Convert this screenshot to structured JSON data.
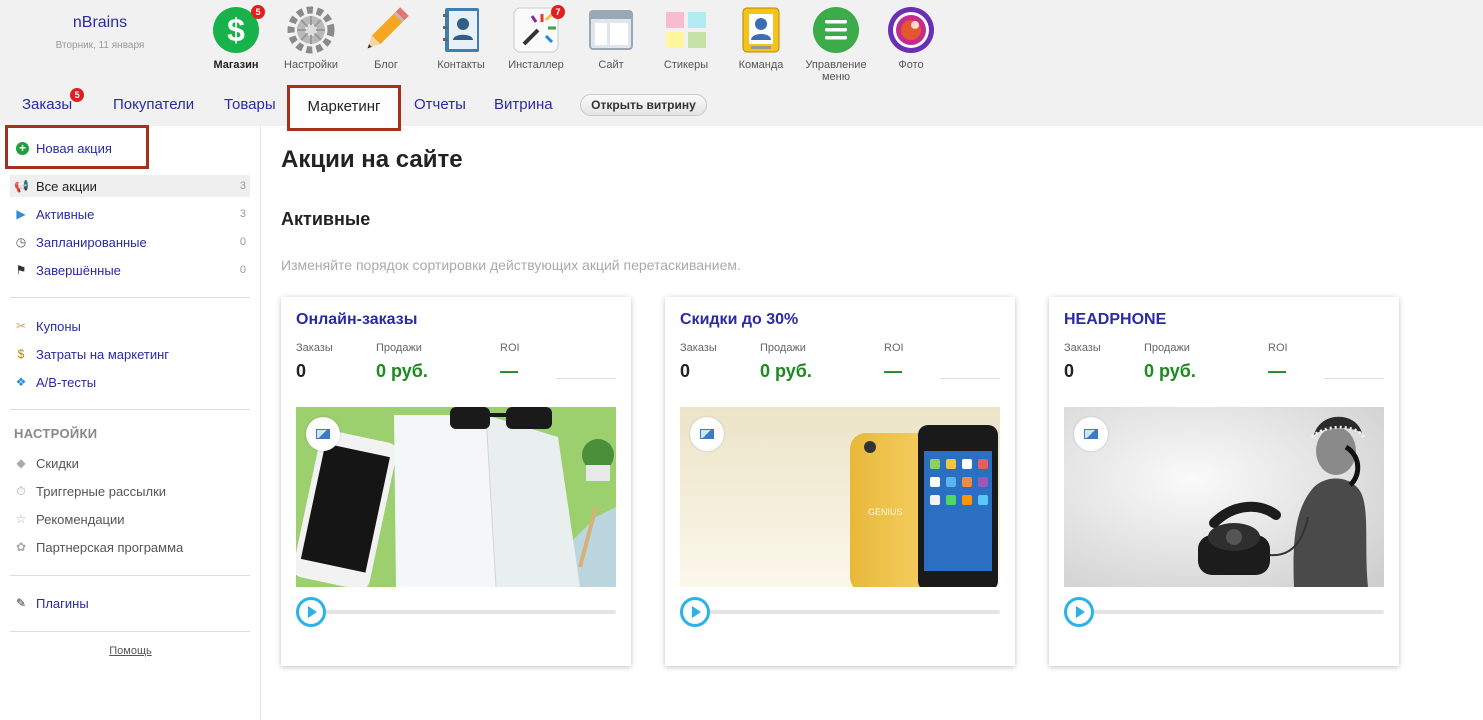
{
  "brand": {
    "name": "nBrains",
    "date": "Вторник, 11 января"
  },
  "apps": [
    {
      "label": "Магазин",
      "badge": "5",
      "icon": "shop-dollar-icon",
      "active": true
    },
    {
      "label": "Настройки",
      "icon": "settings-gear-icon"
    },
    {
      "label": "Блог",
      "icon": "blog-pencil-icon"
    },
    {
      "label": "Контакты",
      "icon": "contacts-book-icon"
    },
    {
      "label": "Инсталлер",
      "badge": "7",
      "icon": "installer-wand-icon"
    },
    {
      "label": "Сайт",
      "icon": "site-window-icon"
    },
    {
      "label": "Стикеры",
      "icon": "stickers-icon"
    },
    {
      "label": "Команда",
      "icon": "team-badge-icon"
    },
    {
      "label": "Управление меню",
      "icon": "menu-manage-icon"
    },
    {
      "label": "Фото",
      "icon": "photo-camera-icon"
    }
  ],
  "tabs": {
    "orders": "Заказы",
    "orders_badge": "5",
    "customers": "Покупатели",
    "products": "Товары",
    "marketing": "Маркетинг",
    "reports": "Отчеты",
    "showcase": "Витрина",
    "open_showcase": "Открыть витрину"
  },
  "sidebar": {
    "new_promo": "Новая акция",
    "promos": [
      {
        "label": "Все акции",
        "count": "3",
        "icon": "megaphone-icon"
      },
      {
        "label": "Активные",
        "count": "3",
        "icon": "play-icon"
      },
      {
        "label": "Запланированные",
        "count": "0",
        "icon": "clock-icon"
      },
      {
        "label": "Завершённые",
        "count": "0",
        "icon": "finish-flag-icon"
      }
    ],
    "tools": [
      {
        "label": "Купоны",
        "icon": "coupon-icon"
      },
      {
        "label": "Затраты на маркетинг",
        "icon": "money-icon"
      },
      {
        "label": "A/B-тесты",
        "icon": "ab-test-icon"
      }
    ],
    "settings_title": "НАСТРОЙКИ",
    "settings": [
      {
        "label": "Скидки",
        "icon": "tag-icon"
      },
      {
        "label": "Триггерные рассылки",
        "icon": "stopwatch-icon"
      },
      {
        "label": "Рекомендации",
        "icon": "star-icon"
      },
      {
        "label": "Партнерская программа",
        "icon": "award-icon"
      }
    ],
    "plugins": {
      "label": "Плагины",
      "icon": "plugin-icon"
    },
    "help": "Помощь"
  },
  "main": {
    "title": "Акции на сайте",
    "section": "Активные",
    "hint": "Изменяйте порядок сортировки действующих акций перетаскиванием.",
    "metric_labels": {
      "orders": "Заказы",
      "sales": "Продажи",
      "roi": "ROI"
    },
    "cards": [
      {
        "title": "Онлайн-заказы",
        "orders": "0",
        "sales": "0 руб.",
        "roi": "—",
        "image": "notebook-phone-photo"
      },
      {
        "title": "Скидки до 30%",
        "orders": "0",
        "sales": "0 руб.",
        "roi": "—",
        "image": "iphone-case-photo"
      },
      {
        "title": "HEADPHONE",
        "orders": "0",
        "sales": "0 руб.",
        "roi": "—",
        "image": "retro-phone-girl-photo"
      }
    ]
  },
  "colors": {
    "link": "#2a2aa5",
    "highlight_border": "#a4311d",
    "sales_green": "#1c8a1c",
    "slider_blue": "#2bb3e8"
  }
}
